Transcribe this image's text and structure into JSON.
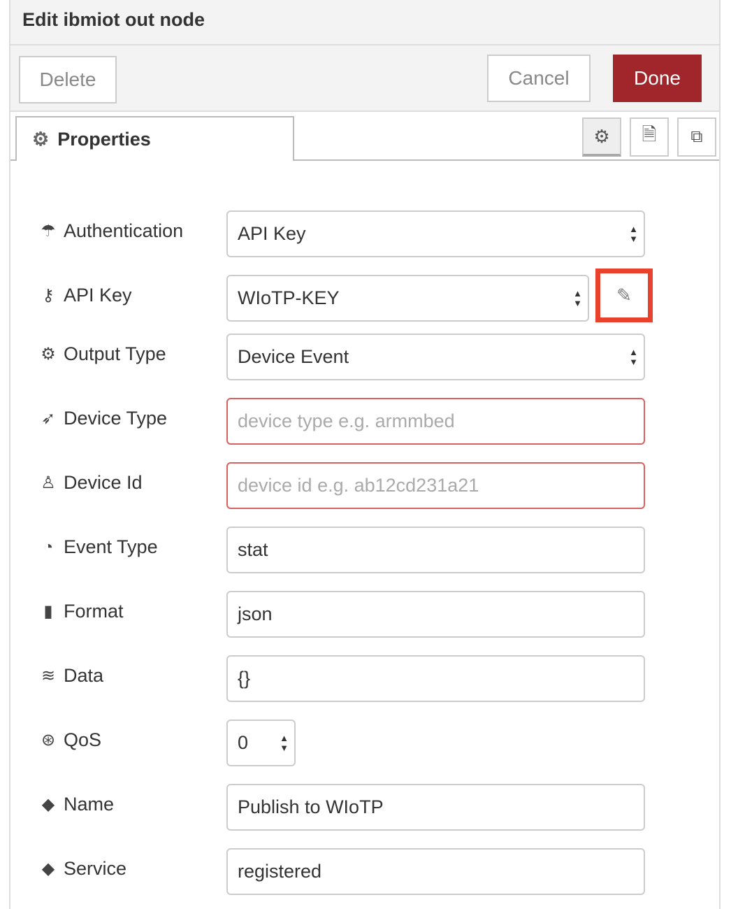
{
  "header": {
    "title": "Edit ibmiot out node"
  },
  "toolbar": {
    "delete": "Delete",
    "cancel": "Cancel",
    "done": "Done"
  },
  "tabs": {
    "properties": "Properties"
  },
  "fields": [
    {
      "label": "Authentication",
      "value": "API Key",
      "type": "select",
      "icon": "umbrella-icon"
    },
    {
      "label": "API Key",
      "value": "WIoTP-KEY",
      "type": "select",
      "icon": "key-icon"
    },
    {
      "label": "Output Type",
      "value": "Device Event",
      "type": "select",
      "icon": "gears-icon"
    },
    {
      "label": "Device Type",
      "placeholder": "device type e.g. armmbed",
      "type": "input",
      "icon": "rocket-icon"
    },
    {
      "label": "Device Id",
      "placeholder": "device id e.g. ab12cd231a21",
      "type": "input",
      "icon": "person-icon"
    },
    {
      "label": "Event Type",
      "value": "stat",
      "type": "input",
      "icon": "dashboard-icon"
    },
    {
      "label": "Format",
      "value": "json",
      "type": "input",
      "icon": "file-icon"
    },
    {
      "label": "Data",
      "value": "{}",
      "type": "input",
      "icon": "database-icon"
    },
    {
      "label": "QoS",
      "value": "0",
      "type": "select",
      "icon": "asterisk-icon"
    },
    {
      "label": "Name",
      "value": "Publish to WIoTP",
      "type": "input",
      "icon": "tag-icon"
    },
    {
      "label": "Service",
      "value": "registered",
      "type": "input",
      "icon": "tag-icon"
    }
  ],
  "colors": {
    "done": "#a0262c",
    "highlight": "#e8412c",
    "error_border": "#d6615e"
  }
}
